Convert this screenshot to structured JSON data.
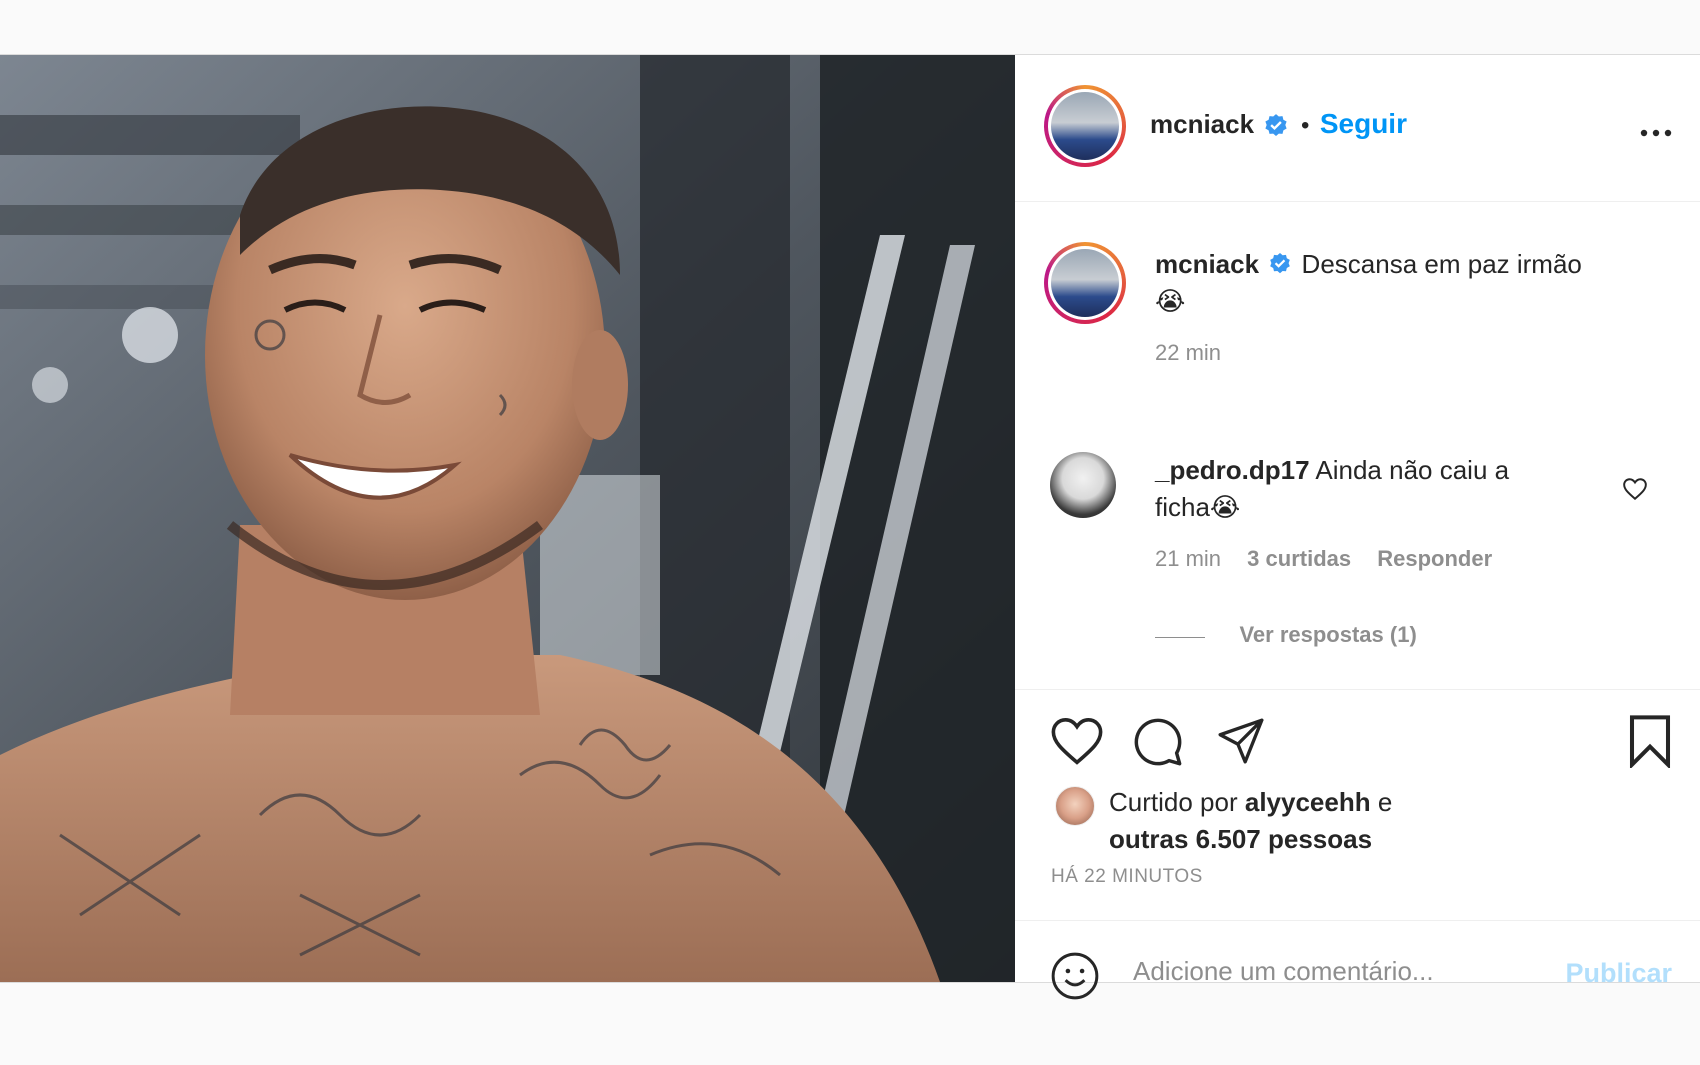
{
  "post": {
    "author": {
      "username": "mcniack",
      "verified": true,
      "follow_label": "Seguir",
      "separator": "•"
    },
    "more_icon": "ellipsis-icon",
    "caption": {
      "username": "mcniack",
      "text": "Descansa em paz irmão",
      "emoji": "😭",
      "time": "22 min"
    },
    "comments": [
      {
        "username": "_pedro.dp17",
        "text_line1": "Ainda não caiu a",
        "text_line2": "ficha😭",
        "time": "21 min",
        "likes": "3 curtidas",
        "reply_label": "Responder",
        "view_replies": "Ver respostas (1)"
      }
    ],
    "actions": {
      "like_icon": "heart-icon",
      "comment_icon": "comment-icon",
      "share_icon": "paper-plane-icon",
      "save_icon": "bookmark-icon"
    },
    "likes": {
      "prefix": "Curtido por",
      "user": "alyyceehh",
      "connector": "e",
      "others": "outras 6.507 pessoas"
    },
    "date": "HÁ 22 MINUTOS",
    "add_comment": {
      "placeholder": "Adicione um comentário...",
      "publish_label": "Publicar",
      "emoji_icon": "smiley-icon"
    }
  },
  "colors": {
    "accent": "#0095f6",
    "publish_disabled": "#b2dffc",
    "muted": "#8e8e8e",
    "text": "#262626"
  }
}
